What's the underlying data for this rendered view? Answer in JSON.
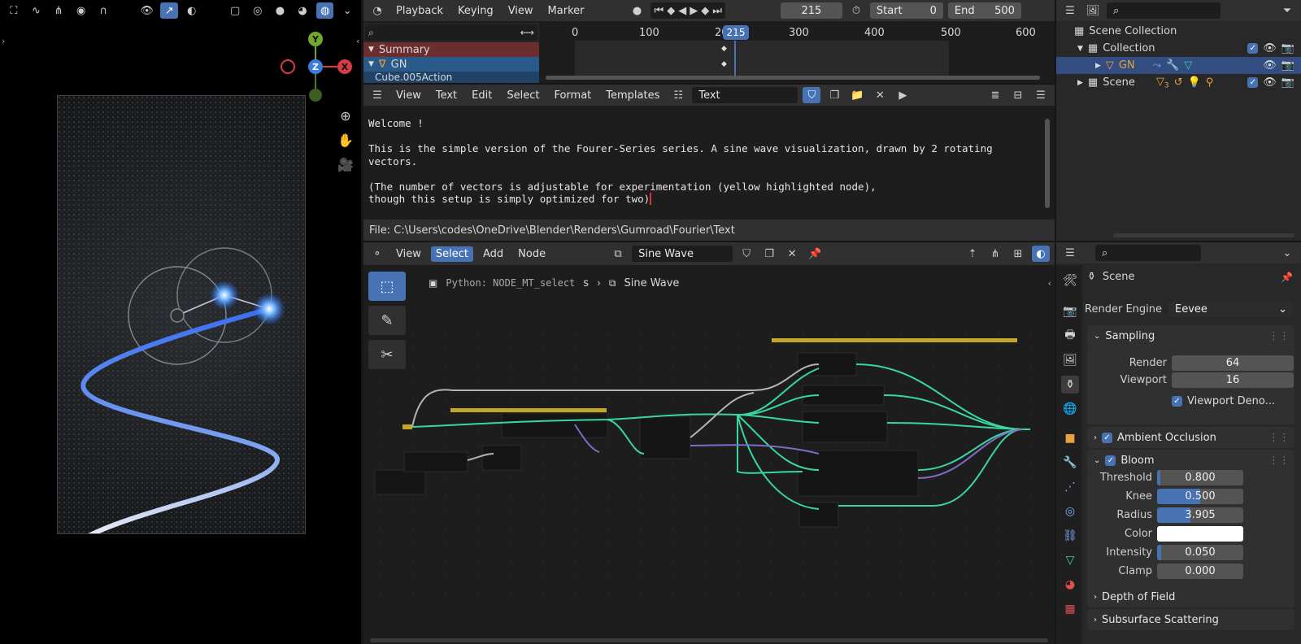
{
  "viewport": {
    "gizmo": {
      "y": "Y",
      "z": "Z",
      "x": "X"
    }
  },
  "timeline": {
    "menu": [
      "Playback",
      "Keying",
      "View",
      "Marker"
    ],
    "current_frame": "215",
    "start_label": "Start",
    "start_value": "0",
    "end_label": "End",
    "end_value": "500",
    "ruler": [
      "0",
      "100",
      "200",
      "300",
      "400",
      "500",
      "600"
    ],
    "playhead": "215",
    "channels": [
      "Summary",
      "GN",
      "Cube.005Action"
    ]
  },
  "text_editor": {
    "menu": [
      "View",
      "Text",
      "Edit",
      "Select",
      "Format",
      "Templates"
    ],
    "datablock": "Text",
    "lines": [
      "Welcome !",
      "",
      "This is the simple version of the Fourer-Series series. A sine wave visualization, drawn by 2 rotating vectors.",
      "",
      "(The number of vectors is adjustable for experimentation (yellow highlighted node),",
      "though this setup is simply optimized for two)"
    ],
    "filepath": "File: C:\\Users\\codes\\OneDrive\\Blender\\Renders\\Gumroad\\Fourier\\Text"
  },
  "node_editor": {
    "menu": [
      "View",
      "Select",
      "Add",
      "Node"
    ],
    "active_menu": "Select",
    "node_tree": "Sine Wave",
    "tooltip": "Python: NODE_MT_select",
    "breadcrumb_partial": "s",
    "breadcrumb": "Sine Wave"
  },
  "outliner": {
    "items": [
      {
        "label": "Scene Collection"
      },
      {
        "label": "Collection"
      },
      {
        "label": "GN"
      },
      {
        "label": "Scene"
      }
    ],
    "scene_badge": "3"
  },
  "properties": {
    "context": "Scene",
    "render_engine_label": "Render Engine",
    "render_engine": "Eevee",
    "sampling": {
      "title": "Sampling",
      "render_label": "Render",
      "render": "64",
      "viewport_label": "Viewport",
      "viewport": "16",
      "denoise_label": "Viewport Deno..."
    },
    "ao_title": "Ambient Occlusion",
    "bloom": {
      "title": "Bloom",
      "threshold_label": "Threshold",
      "threshold": "0.800",
      "threshold_frac": 0.04,
      "knee_label": "Knee",
      "knee": "0.500",
      "knee_frac": 0.5,
      "radius_label": "Radius",
      "radius": "3.905",
      "radius_frac": 0.39,
      "color_label": "Color",
      "color": "#ffffff",
      "intensity_label": "Intensity",
      "intensity": "0.050",
      "intensity_frac": 0.05,
      "clamp_label": "Clamp",
      "clamp": "0.000"
    },
    "dof_title": "Depth of Field",
    "sss_title": "Subsurface Scattering"
  },
  "colors": {
    "accent": "#4772b3",
    "node_link_green": "#39d6a5",
    "frame_yellow": "#c4a72a",
    "orange": "#e8a23d"
  }
}
